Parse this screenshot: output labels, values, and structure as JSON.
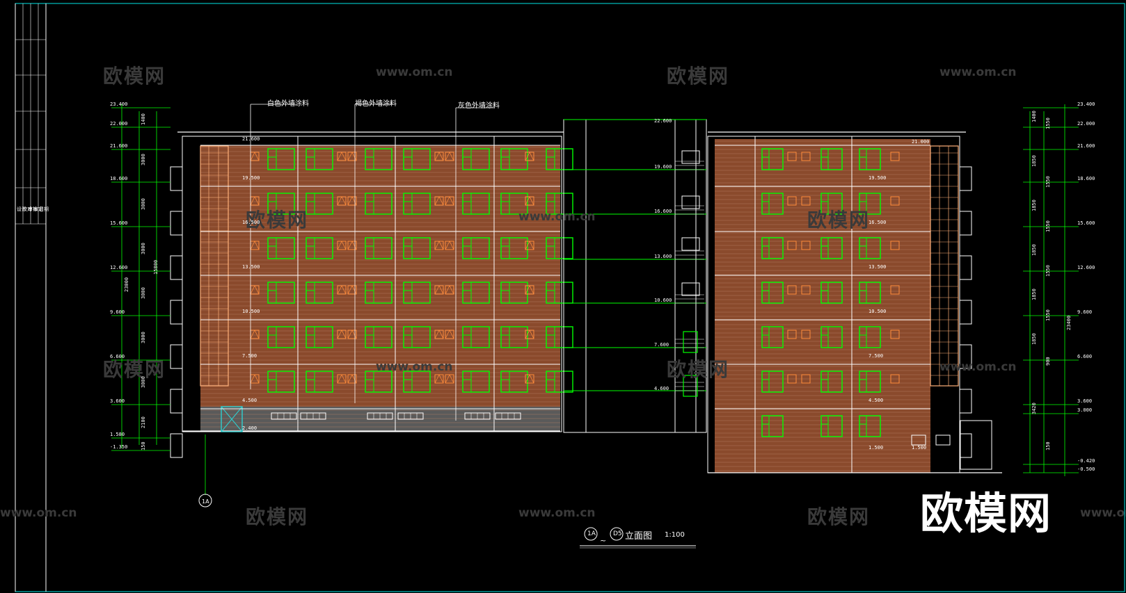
{
  "watermarks": {
    "brand_small": "欧模网",
    "url": "www.om.cn",
    "brand_large": "欧模网"
  },
  "material_labels": {
    "white": "白色外墙涂料",
    "brown": "褐色外墙涂料",
    "gray": "灰色外墙涂料"
  },
  "drawing_title": {
    "axis_start": "1A",
    "tilde": "~",
    "axis_end": "D5",
    "name": "立面图",
    "scale": "1:100"
  },
  "bottom_axis_marker": "1A",
  "left_elevations": [
    "23.400",
    "22.000",
    "21.600",
    "18.600",
    "15.600",
    "12.600",
    "9.600",
    "6.600",
    "3.600",
    "1.580",
    "-1.350"
  ],
  "right_elevations": [
    "23.400",
    "22.000",
    "21.600",
    "18.600",
    "15.600",
    "12.600",
    "9.600",
    "6.600",
    "3.600",
    "3.000",
    "-0.420",
    "-0.500"
  ],
  "left_dims": [
    "1400",
    "3000",
    "3000",
    "3000",
    "3000",
    "3000",
    "3000",
    "2100",
    "150"
  ],
  "left_total_dims": [
    "15800",
    "23000"
  ],
  "right_dims": [
    "1400",
    "1550",
    "1850",
    "1550",
    "1850",
    "1550",
    "1850",
    "1550",
    "1850",
    "1550",
    "1850",
    "900",
    "3420",
    "150"
  ],
  "right_total_dim": "23400",
  "floor_marks_left": [
    "21.600",
    "19.500",
    "16.500",
    "13.500",
    "10.500",
    "7.500",
    "4.500",
    "2.400"
  ],
  "floor_marks_mid": [
    "22.600",
    "19.600",
    "16.600",
    "13.600",
    "10.600",
    "7.600",
    "4.600"
  ],
  "floor_marks_right": [
    "21.000",
    "19.500",
    "16.500",
    "13.500",
    "10.500",
    "7.500",
    "4.500",
    "1.500",
    "1.500"
  ],
  "side_notes_left": [
    "设计",
    "校对",
    "审核",
    "审定",
    "日期"
  ],
  "colors": {
    "line_white": "#ffffff",
    "line_green": "#00ff00",
    "line_cyan": "#00e5e5",
    "wall_brown": "#8a4a2c",
    "vent_orange": "#ff8c3c",
    "panel_peach": "#ffb07a",
    "frame_cyan": "#2ecfd0"
  }
}
